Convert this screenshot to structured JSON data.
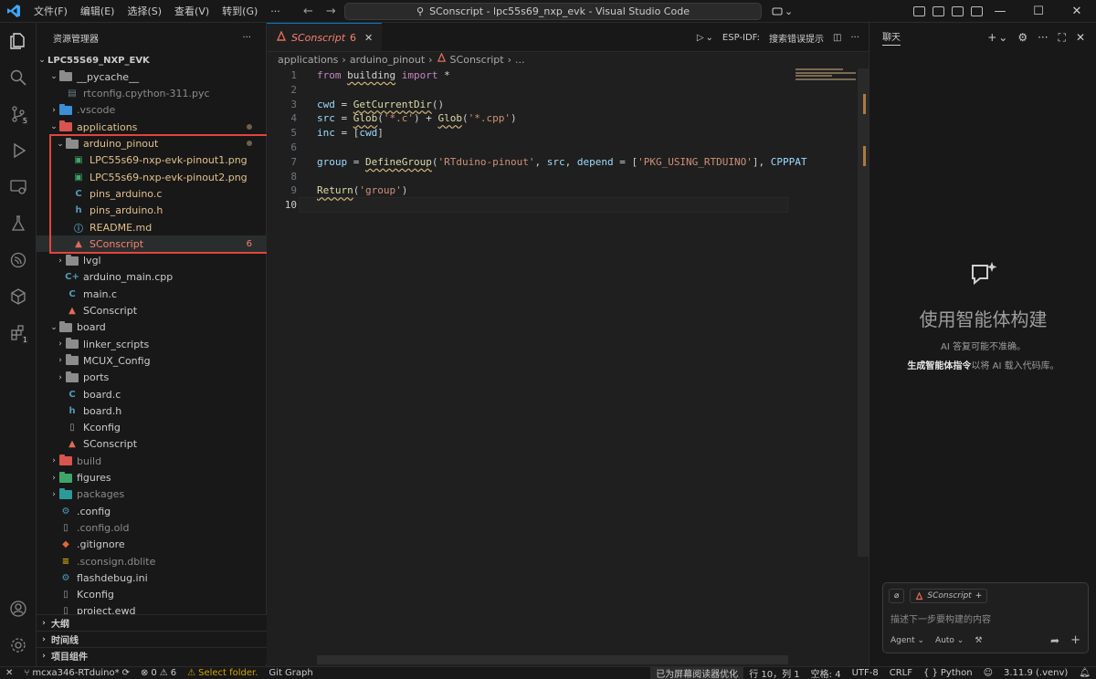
{
  "titlebar": {
    "menu": [
      "文件(F)",
      "编辑(E)",
      "选择(S)",
      "查看(V)",
      "转到(G)",
      "···"
    ],
    "search_text": "SConscript - lpc55s69_nxp_evk - Visual Studio Code",
    "window_buttons": [
      "—",
      "☐",
      "✕"
    ]
  },
  "activity": {
    "explorer_badge": "",
    "scm_badge": "5",
    "ext_badge": "1"
  },
  "sidebar": {
    "title": "资源管理器",
    "more": "···",
    "tree": [
      {
        "label": "LPC55S69_NXP_EVK",
        "chev": "v",
        "icon": "",
        "depth": 0,
        "style": "bold"
      },
      {
        "label": "__pycache__",
        "chev": "v",
        "icon": "folder",
        "depth": 1,
        "style": ""
      },
      {
        "label": "rtconfig.cpython-311.pyc",
        "chev": "",
        "icon": "pyc",
        "depth": 2,
        "style": "dim"
      },
      {
        "label": ".vscode",
        "chev": ">",
        "icon": "folder-vs",
        "depth": 1,
        "style": "dim"
      },
      {
        "label": "applications",
        "chev": "v",
        "icon": "folder-red",
        "depth": 1,
        "style": "mod",
        "right": "dot"
      },
      {
        "label": "arduino_pinout",
        "chev": "v",
        "icon": "folder",
        "depth": 2,
        "style": "mod",
        "right": "dot"
      },
      {
        "label": "LPC55s69-nxp-evk-pinout1.png",
        "chev": "",
        "icon": "png",
        "depth": 3,
        "style": "mod"
      },
      {
        "label": "LPC55s69-nxp-evk-pinout2.png",
        "chev": "",
        "icon": "png",
        "depth": 3,
        "style": "mod"
      },
      {
        "label": "pins_arduino.c",
        "chev": "",
        "icon": "c",
        "depth": 3,
        "style": "mod"
      },
      {
        "label": "pins_arduino.h",
        "chev": "",
        "icon": "h",
        "depth": 3,
        "style": "mod"
      },
      {
        "label": "README.md",
        "chev": "",
        "icon": "info",
        "depth": 3,
        "style": "mod"
      },
      {
        "label": "SConscript",
        "chev": "",
        "icon": "scons",
        "depth": 3,
        "style": "err",
        "right": "6",
        "selected": true
      },
      {
        "label": "lvgl",
        "chev": ">",
        "icon": "folder",
        "depth": 2,
        "style": ""
      },
      {
        "label": "arduino_main.cpp",
        "chev": "",
        "icon": "cpp",
        "depth": 2,
        "style": ""
      },
      {
        "label": "main.c",
        "chev": "",
        "icon": "c",
        "depth": 2,
        "style": ""
      },
      {
        "label": "SConscript",
        "chev": "",
        "icon": "scons",
        "depth": 2,
        "style": ""
      },
      {
        "label": "board",
        "chev": "v",
        "icon": "folder",
        "depth": 1,
        "style": ""
      },
      {
        "label": "linker_scripts",
        "chev": ">",
        "icon": "folder",
        "depth": 2,
        "style": ""
      },
      {
        "label": "MCUX_Config",
        "chev": ">",
        "icon": "folder",
        "depth": 2,
        "style": ""
      },
      {
        "label": "ports",
        "chev": ">",
        "icon": "folder",
        "depth": 2,
        "style": ""
      },
      {
        "label": "board.c",
        "chev": "",
        "icon": "c",
        "depth": 2,
        "style": ""
      },
      {
        "label": "board.h",
        "chev": "",
        "icon": "h",
        "depth": 2,
        "style": ""
      },
      {
        "label": "Kconfig",
        "chev": "",
        "icon": "file",
        "depth": 2,
        "style": ""
      },
      {
        "label": "SConscript",
        "chev": "",
        "icon": "scons",
        "depth": 2,
        "style": ""
      },
      {
        "label": "build",
        "chev": ">",
        "icon": "folder-red",
        "depth": 1,
        "style": "dim"
      },
      {
        "label": "figures",
        "chev": ">",
        "icon": "folder-green",
        "depth": 1,
        "style": ""
      },
      {
        "label": "packages",
        "chev": ">",
        "icon": "folder-teal",
        "depth": 1,
        "style": "dim"
      },
      {
        "label": ".config",
        "chev": "",
        "icon": "gear",
        "depth": 1,
        "style": ""
      },
      {
        "label": ".config.old",
        "chev": "",
        "icon": "file",
        "depth": 1,
        "style": "dim"
      },
      {
        "label": ".gitignore",
        "chev": "",
        "icon": "git",
        "depth": 1,
        "style": ""
      },
      {
        "label": ".sconsign.dblite",
        "chev": "",
        "icon": "db",
        "depth": 1,
        "style": "dim"
      },
      {
        "label": "flashdebug.ini",
        "chev": "",
        "icon": "gear",
        "depth": 1,
        "style": ""
      },
      {
        "label": "Kconfig",
        "chev": "",
        "icon": "file",
        "depth": 1,
        "style": ""
      },
      {
        "label": "project.ewd",
        "chev": "",
        "icon": "file",
        "depth": 1,
        "style": ""
      }
    ],
    "sections": [
      "大纲",
      "时间线",
      "项目组件"
    ]
  },
  "editor": {
    "tab": {
      "label": "SConscript",
      "count": "6",
      "close": "✕"
    },
    "actions": {
      "run": "▷",
      "esp": "ESP-IDF:",
      "search_hint": "搜索错误提示",
      "more": "···"
    },
    "breadcrumb": [
      "applications",
      "arduino_pinout",
      "SConscript",
      "..."
    ],
    "lines": [
      {
        "n": "1",
        "tokens": [
          [
            "k",
            "from"
          ],
          [
            "t",
            " "
          ],
          [
            "sq",
            "building"
          ],
          [
            "t",
            " "
          ],
          [
            "k",
            "import"
          ],
          [
            "t",
            " *"
          ]
        ]
      },
      {
        "n": "2",
        "tokens": []
      },
      {
        "n": "3",
        "tokens": [
          [
            "v",
            "cwd"
          ],
          [
            "t",
            " = "
          ],
          [
            "fsq",
            "GetCurrentDir"
          ],
          [
            "p",
            "()"
          ]
        ]
      },
      {
        "n": "4",
        "tokens": [
          [
            "v",
            "src"
          ],
          [
            "t",
            " = "
          ],
          [
            "fsq",
            "Glob"
          ],
          [
            "p",
            "("
          ],
          [
            "s",
            "'*.c'"
          ],
          [
            "p",
            ")"
          ],
          [
            "t",
            " + "
          ],
          [
            "fsq",
            "Glob"
          ],
          [
            "p",
            "("
          ],
          [
            "s",
            "'*.cpp'"
          ],
          [
            "p",
            ")"
          ]
        ]
      },
      {
        "n": "5",
        "tokens": [
          [
            "v",
            "inc"
          ],
          [
            "t",
            " = "
          ],
          [
            "p",
            "["
          ],
          [
            "v",
            "cwd"
          ],
          [
            "p",
            "]"
          ]
        ]
      },
      {
        "n": "6",
        "tokens": []
      },
      {
        "n": "7",
        "tokens": [
          [
            "v",
            "group"
          ],
          [
            "t",
            " = "
          ],
          [
            "fsq",
            "DefineGroup"
          ],
          [
            "p",
            "("
          ],
          [
            "s",
            "'RTduino-pinout'"
          ],
          [
            "t",
            ", "
          ],
          [
            "v",
            "src"
          ],
          [
            "t",
            ", "
          ],
          [
            "v",
            "depend"
          ],
          [
            "t",
            " = "
          ],
          [
            "p",
            "["
          ],
          [
            "s",
            "'PKG_USING_RTDUINO'"
          ],
          [
            "p",
            "]"
          ],
          [
            "t",
            ", "
          ],
          [
            "v",
            "CPPPAT"
          ]
        ]
      },
      {
        "n": "8",
        "tokens": []
      },
      {
        "n": "9",
        "tokens": [
          [
            "fsq",
            "Return"
          ],
          [
            "p",
            "("
          ],
          [
            "s",
            "'group'"
          ],
          [
            "p",
            ")"
          ]
        ]
      },
      {
        "n": "10",
        "tokens": []
      }
    ]
  },
  "chat": {
    "title": "聊天",
    "tools": [
      "+",
      "⌄",
      "⚙",
      "···",
      "⛶",
      "✕"
    ],
    "welcome_title": "使用智能体构建",
    "welcome_sub": "AI 答复可能不准确。",
    "welcome_link": "生成智能体指令",
    "welcome_link_rest": "以将 AI 载入代码库。",
    "context_file": "SConscript",
    "input_placeholder": "描述下一步要构建的内容",
    "mode": "Agent ⌄",
    "model": "Auto ⌄"
  },
  "status": {
    "branch": "mcxa346-RTduino*",
    "errors": "0",
    "warnings": "6",
    "select_folder": "Select folder.",
    "git_graph": "Git Graph",
    "screen_reader": "已为屏幕阅读器优化",
    "position": "行 10，列 1",
    "spaces": "空格: 4",
    "encoding": "UTF-8",
    "eol": "CRLF",
    "language": "Python",
    "interpreter": "3.11.9 (.venv)"
  }
}
